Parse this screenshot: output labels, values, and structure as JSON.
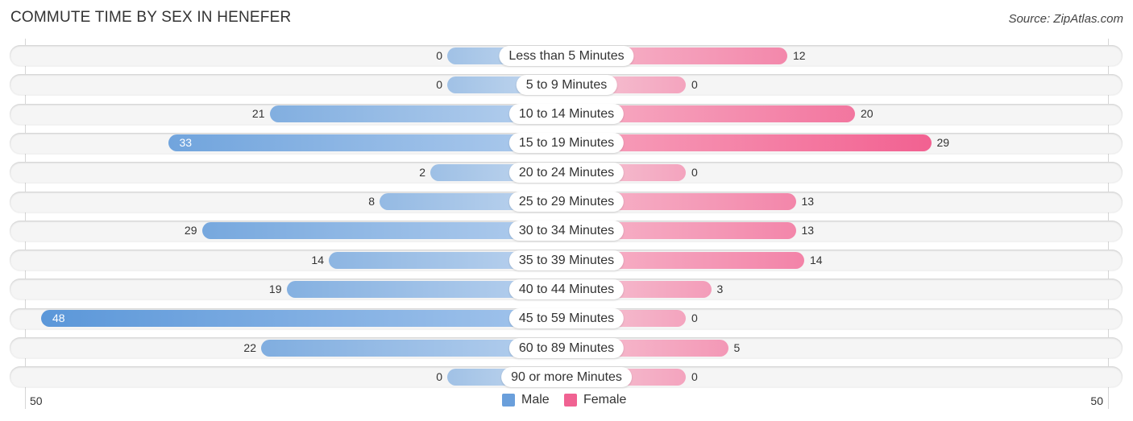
{
  "title": "COMMUTE TIME BY SEX IN HENEFER",
  "source": "Source: ZipAtlas.com",
  "colors": {
    "male": "#6a9fdb",
    "female": "#f06292"
  },
  "chart_data": {
    "type": "bar",
    "orientation": "horizontal-diverging",
    "title": "COMMUTE TIME BY SEX IN HENEFER",
    "categories": [
      "Less than 5 Minutes",
      "5 to 9 Minutes",
      "10 to 14 Minutes",
      "15 to 19 Minutes",
      "20 to 24 Minutes",
      "25 to 29 Minutes",
      "30 to 34 Minutes",
      "35 to 39 Minutes",
      "40 to 44 Minutes",
      "45 to 59 Minutes",
      "60 to 89 Minutes",
      "90 or more Minutes"
    ],
    "series": [
      {
        "name": "Male",
        "values": [
          0,
          0,
          21,
          33,
          2,
          8,
          29,
          14,
          19,
          48,
          22,
          0
        ]
      },
      {
        "name": "Female",
        "values": [
          12,
          0,
          20,
          29,
          0,
          13,
          13,
          14,
          3,
          0,
          5,
          0
        ]
      }
    ],
    "axis_min_label": "50",
    "axis_max_label": "50",
    "xlim": [
      -50,
      50
    ],
    "legend": [
      "Male",
      "Female"
    ],
    "legend_position": "bottom-center"
  }
}
